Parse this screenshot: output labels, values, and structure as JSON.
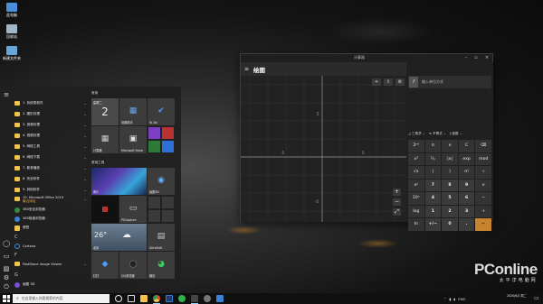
{
  "desktop": {
    "icons": [
      {
        "label": "此电脑",
        "icon": "computer-icon",
        "color": "#4a90d9"
      },
      {
        "label": "回收站",
        "icon": "recycle-bin-icon",
        "color": "#9fb7c9"
      },
      {
        "label": "新建文件夹",
        "icon": "folder-icon",
        "color": "#6aa5d8"
      }
    ]
  },
  "start_menu": {
    "rail_icons": [
      "hamburger-icon",
      "user-icon",
      "document-icon",
      "pictures-icon",
      "settings-icon",
      "power-icon"
    ],
    "apps": [
      {
        "label": "1. 系统类软件",
        "type": "folder"
      },
      {
        "label": "2. 图形处理",
        "type": "folder"
      },
      {
        "label": "3. 音频处理",
        "type": "folder"
      },
      {
        "label": "4. 视频处理",
        "type": "folder"
      },
      {
        "label": "5. 网络工具",
        "type": "folder"
      },
      {
        "label": "6. 网络下载",
        "type": "folder"
      },
      {
        "label": "7. 影音播放",
        "type": "folder"
      },
      {
        "label": "8. 安全软件",
        "type": "folder"
      },
      {
        "label": "9. 其他软件",
        "type": "folder"
      },
      {
        "label": "10. Microsoft Office 2019",
        "type": "folder"
      },
      {
        "label": "360安全浏览器",
        "type": "app",
        "color": "#2f8f3f"
      },
      {
        "label": "360极速浏览器",
        "type": "app",
        "color": "#3b82d6"
      },
      {
        "label": "便签",
        "type": "app",
        "color": "#f2c24a"
      },
      {
        "label": "C",
        "type": "letter"
      },
      {
        "label": "Cortana",
        "type": "app",
        "color": "#3d8fe0"
      },
      {
        "label": "F",
        "type": "letter"
      },
      {
        "label": "FastStone Image Viewer",
        "type": "folder"
      },
      {
        "label": "G",
        "type": "letter"
      },
      {
        "label": "画图 3D",
        "type": "app",
        "color": "#7a4fd1"
      }
    ],
    "app_subtext": "最近添加",
    "tile_groups": [
      "常用",
      "常用工具"
    ],
    "tiles": [
      {
        "label": "星期二",
        "value": "2",
        "kind": "calendar"
      },
      {
        "label": "设置助手",
        "kind": "app",
        "glyph": "▦",
        "color": "#3a6fb0"
      },
      {
        "label": "To-Do",
        "kind": "app",
        "glyph": "✔",
        "color": "#2f6fd8"
      },
      {
        "label": "计算器",
        "kind": "app",
        "glyph": "▦",
        "color": "#444"
      },
      {
        "label": "Microsoft Store",
        "kind": "app",
        "glyph": "🛍",
        "color": "#333"
      },
      {
        "label": "",
        "kind": "mini",
        "color": "#7c3ec2"
      },
      {
        "label": "照片",
        "kind": "photo"
      },
      {
        "label": "画图3D",
        "kind": "app",
        "glyph": "◉",
        "color": "#2c6fb5"
      },
      {
        "label": "",
        "kind": "dark"
      },
      {
        "label": "PSCapture",
        "kind": "app",
        "glyph": "▭",
        "color": "#333"
      },
      {
        "label": "",
        "kind": "mini",
        "color": "#3a3a3a"
      },
      {
        "label": "26°",
        "value": "北京",
        "kind": "weather"
      },
      {
        "label": "UltraEdit",
        "kind": "app",
        "glyph": "▤",
        "color": "#3a3a3a"
      },
      {
        "label": "钉钉",
        "kind": "app",
        "glyph": "◆",
        "color": "#2f7fd8"
      },
      {
        "label": "QQ浏览器",
        "kind": "app",
        "glyph": "●",
        "color": "#333"
      },
      {
        "label": "微信",
        "kind": "app",
        "glyph": "◕",
        "color": "#2fb34a"
      }
    ]
  },
  "calculator": {
    "window_title": "计算器",
    "mode_title": "绘图",
    "equation_placeholder": "输入单位方式",
    "x_ticks": [
      "-5",
      "5"
    ],
    "y_ticks": [
      "5",
      "-5"
    ],
    "func_tabs": [
      "三角学",
      "不等式",
      "函数"
    ],
    "keys": [
      "2ⁿᵈ",
      "π",
      "e",
      "C",
      "⌫",
      "x²",
      "¹/ₓ",
      "|x|",
      "exp",
      "mod",
      "√x",
      "(",
      ")",
      "n!",
      "÷",
      "xʸ",
      "7",
      "8",
      "9",
      "×",
      "10ˣ",
      "4",
      "5",
      "6",
      "−",
      "log",
      "1",
      "2",
      "3",
      "+",
      "ln",
      "+/−",
      "0",
      ".",
      "↵"
    ],
    "zoom_in": "+",
    "zoom_out": "−",
    "reset": "⤢",
    "accent": "#c8832e"
  },
  "taskbar": {
    "search_placeholder": "在这里输入你要搜索的内容",
    "tray_text": "ENG",
    "time": "2020/6/2 周二",
    "time_line1": "",
    "pinned_icons": [
      {
        "icon": "cortana-icon",
        "color": "#eee"
      },
      {
        "icon": "task-view-icon",
        "color": "#ddd"
      },
      {
        "icon": "file-explorer-icon",
        "color": "#f2c24a"
      },
      {
        "icon": "chrome-icon",
        "color": "#e34b3c"
      },
      {
        "icon": "photoshop-icon",
        "color": "#2f7fd8"
      },
      {
        "icon": "wechat-icon",
        "color": "#2fb34a"
      },
      {
        "icon": "calculator-icon",
        "color": "#444"
      },
      {
        "icon": "settings-icon",
        "color": "#999"
      },
      {
        "icon": "mail-icon",
        "color": "#3b82d6"
      }
    ]
  },
  "watermark": {
    "brand": "PConline",
    "sub": "太平洋电脑网"
  }
}
